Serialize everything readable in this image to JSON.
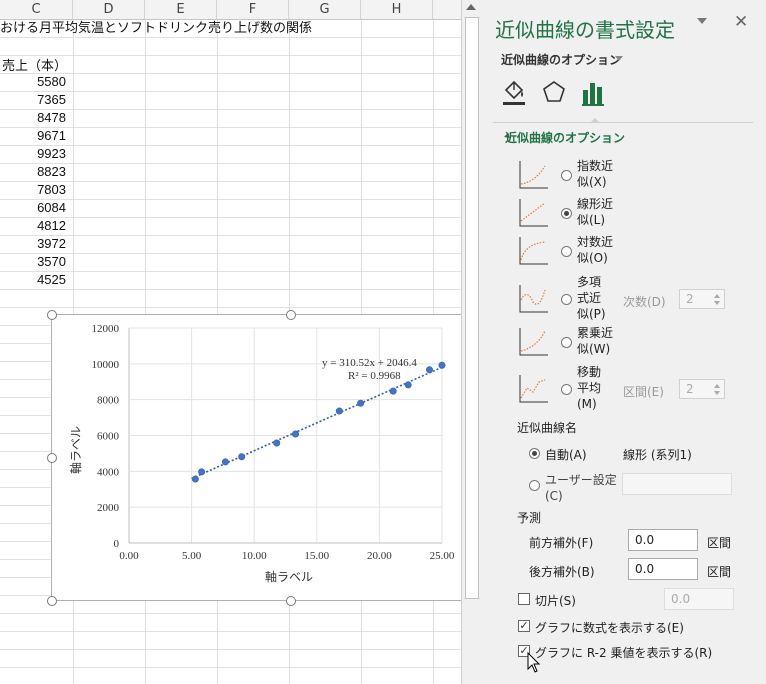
{
  "sheet": {
    "columns": [
      "C",
      "D",
      "E",
      "F",
      "G",
      "H"
    ],
    "title_text": "おける月平均気温とソフトドリンク売り上げ数の関係",
    "header_cell": "売上（本）",
    "values": [
      "5580",
      "7365",
      "8478",
      "9671",
      "9923",
      "8823",
      "7803",
      "6084",
      "4812",
      "3972",
      "3570",
      "4525"
    ]
  },
  "chart": {
    "equation": "y = 310.52x + 2046.4",
    "r2": "R² = 0.9968",
    "xlabel": "軸ラベル",
    "ylabel": "軸ラベル",
    "x_ticks": [
      "0.00",
      "5.00",
      "10.00",
      "15.00",
      "20.00",
      "25.00"
    ],
    "y_ticks": [
      "0",
      "2000",
      "4000",
      "6000",
      "8000",
      "10000",
      "12000"
    ]
  },
  "chart_data": {
    "type": "scatter",
    "title": "",
    "xlabel": "軸ラベル",
    "ylabel": "軸ラベル",
    "xlim": [
      0,
      25
    ],
    "ylim": [
      0,
      12000
    ],
    "grid": true,
    "series": [
      {
        "points": [
          [
            5.3,
            3570
          ],
          [
            5.8,
            3972
          ],
          [
            7.7,
            4525
          ],
          [
            9.0,
            4812
          ],
          [
            11.8,
            5580
          ],
          [
            13.3,
            6084
          ],
          [
            16.8,
            7365
          ],
          [
            18.5,
            7803
          ],
          [
            21.1,
            8478
          ],
          [
            22.3,
            8823
          ],
          [
            24.0,
            9671
          ],
          [
            25.0,
            9923
          ]
        ]
      }
    ],
    "trendline": {
      "type": "linear",
      "slope": 310.52,
      "intercept": 2046.4,
      "r2": 0.9968,
      "x_range": [
        5.0,
        25.0
      ]
    }
  },
  "pane": {
    "title": "近似曲線の書式設定",
    "options_selector": "近似曲線のオプション",
    "section": "近似曲線のオプション",
    "trend_options": [
      {
        "label": "指数近\n似(X)"
      },
      {
        "label": "線形近\n似(L)"
      },
      {
        "label": "対数近\n似(O)"
      },
      {
        "label": "多項\n式近\n似(P)",
        "extra_label": "次数(D)",
        "extra_value": "2"
      },
      {
        "label": "累乗近\n似(W)"
      },
      {
        "label": "移動\n平均\n(M)",
        "extra_label": "区間(E)",
        "extra_value": "2"
      }
    ],
    "name_header": "近似曲線名",
    "auto_label": "自動(A)",
    "auto_value": "線形 (系列1)",
    "custom_label": "ユーザー設定\n(C)",
    "forecast_header": "予測",
    "forward_label": "前方補外(F)",
    "forward_value": "0.0",
    "backward_label": "後方補外(B)",
    "backward_value": "0.0",
    "period_unit": "区間",
    "intercept_label": "切片(S)",
    "intercept_value": "0.0",
    "show_equation_label": "グラフに数式を表示する(E)",
    "show_r2_label": "グラフに R-2 乗値を表示する(R)"
  }
}
